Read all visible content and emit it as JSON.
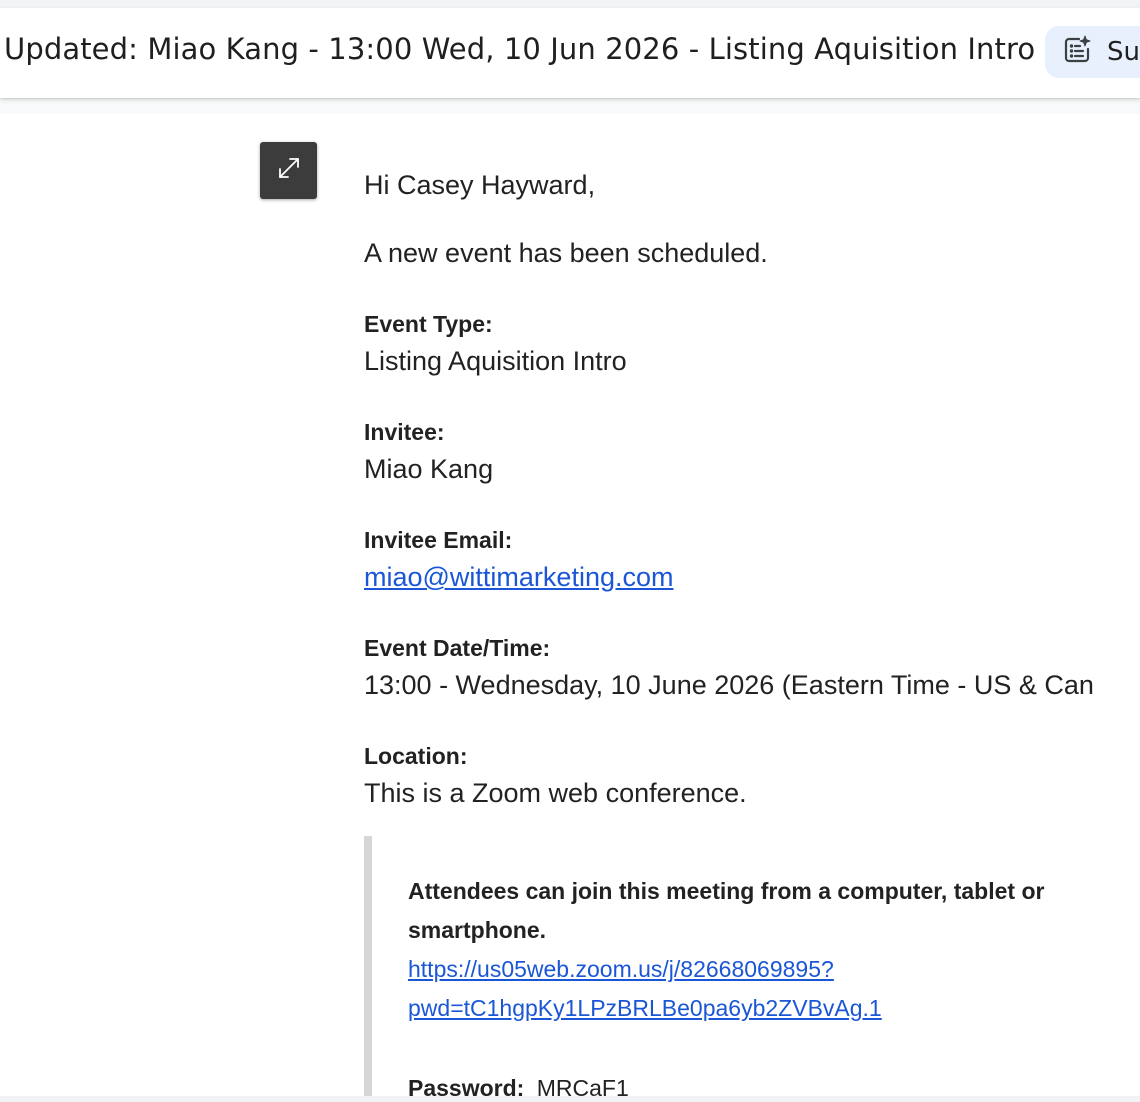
{
  "header": {
    "subject": "Updated: Miao Kang - 13:00 Wed, 10 Jun 2026 - Listing Aquisition Intro",
    "summarize_label": "Su",
    "summarize_icon": "sparkle-list-icon"
  },
  "toolbar": {
    "expand_icon": "expand-diagonal-icon"
  },
  "email": {
    "greeting": "Hi Casey Hayward,",
    "intro": "A new event has been scheduled.",
    "event_type_label": "Event Type:",
    "event_type_value": "Listing Aquisition Intro",
    "invitee_label": "Invitee:",
    "invitee_value": "Miao Kang",
    "invitee_email_label": "Invitee Email:",
    "invitee_email_value": "miao@wittimarketing.com",
    "datetime_label": "Event Date/Time:",
    "datetime_value": "13:00 - Wednesday, 10 June 2026 (Eastern Time - US & Can",
    "location_label": "Location:",
    "location_value": "This is a Zoom web conference.",
    "quote": {
      "join_line1": "Attendees can join this meeting from a computer, tablet or",
      "join_line2": "smartphone.",
      "link_line1": "https://us05web.zoom.us/j/82668069895?",
      "link_line2": "pwd=tC1hgpKy1LPzBRLBe0pa6yb2ZVBvAg.1",
      "password_label": "Password:",
      "password_value": "MRCaF1"
    }
  },
  "colors": {
    "link": "#1a56d6",
    "summarize_bg": "#e8f0fe",
    "expand_bg": "#3c3c3c"
  }
}
